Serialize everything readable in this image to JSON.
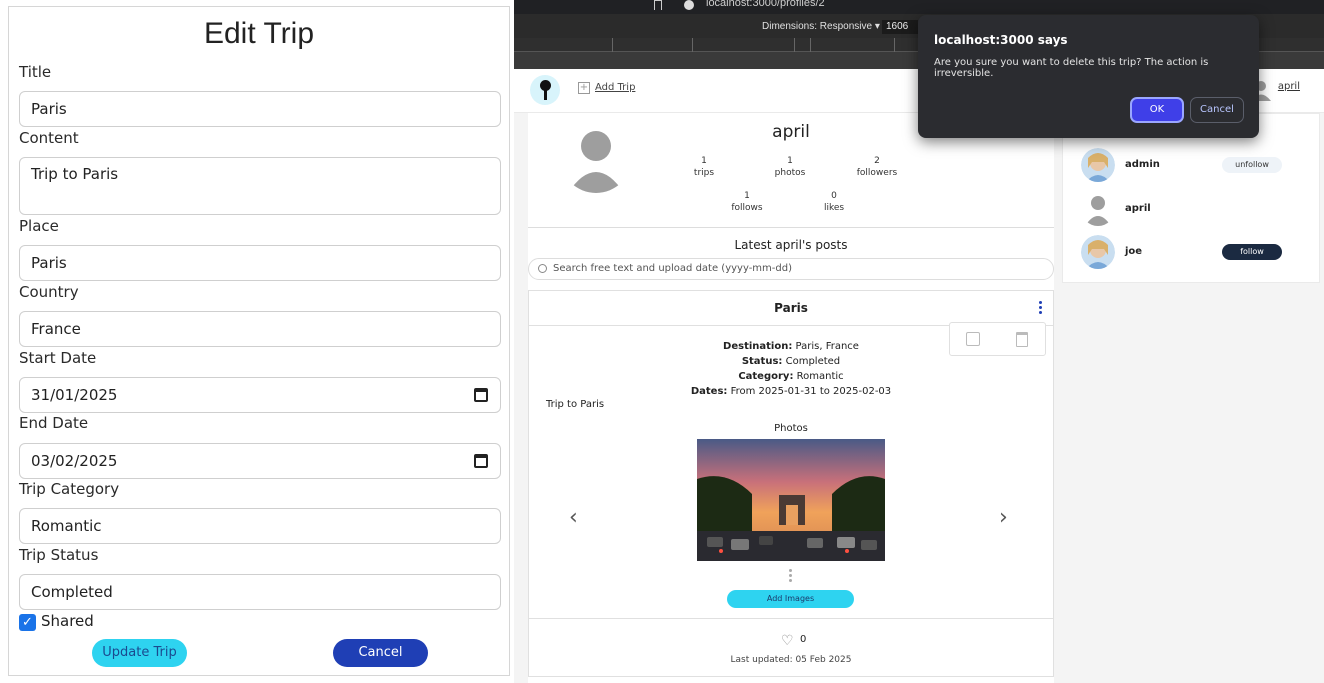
{
  "edit_form": {
    "title": "Edit Trip",
    "fields": {
      "title": {
        "label": "Title",
        "value": "Paris"
      },
      "content": {
        "label": "Content",
        "value": "Trip to Paris"
      },
      "place": {
        "label": "Place",
        "value": "Paris"
      },
      "country": {
        "label": "Country",
        "value": "France"
      },
      "start_date": {
        "label": "Start Date",
        "value": "31/01/2025"
      },
      "end_date": {
        "label": "End Date",
        "value": "03/02/2025"
      },
      "category": {
        "label": "Trip Category",
        "value": "Romantic"
      },
      "status": {
        "label": "Trip Status",
        "value": "Completed"
      }
    },
    "shared": {
      "label": "Shared",
      "checked": true
    },
    "update_label": "Update Trip",
    "cancel_label": "Cancel"
  },
  "browser": {
    "url": "localhost:3000/profiles/2",
    "devtools": {
      "dimensions_label": "Dimensions: Responsive ▾",
      "width_value": "1606"
    }
  },
  "navbar": {
    "add_trip_label": "Add Trip",
    "user_label": "april"
  },
  "profile": {
    "name": "april",
    "stats": [
      {
        "value": "1",
        "label": "trips"
      },
      {
        "value": "1",
        "label": "photos"
      },
      {
        "value": "2",
        "label": "followers"
      },
      {
        "value": "1",
        "label": "follows"
      },
      {
        "value": "0",
        "label": "likes"
      }
    ],
    "latest_title": "Latest april's posts",
    "search_placeholder": "Search free text and upload date (yyyy-mm-dd)"
  },
  "post": {
    "title": "Paris",
    "destination_label": "Destination:",
    "destination_value": "Paris, France",
    "status_label": "Status:",
    "status_value": "Completed",
    "category_label": "Category:",
    "category_value": "Romantic",
    "dates_label": "Dates:",
    "dates_value": "From 2025-01-31 to 2025-02-03",
    "content": "Trip to Paris",
    "photos_label": "Photos",
    "add_images_label": "Add Images",
    "likes": "0",
    "last_updated": "Last updated: 05 Feb 2025"
  },
  "users": [
    {
      "name": "admin",
      "button": "unfollow"
    },
    {
      "name": "april",
      "button": ""
    },
    {
      "name": "joe",
      "button": "follow"
    }
  ],
  "dialog": {
    "title": "localhost:3000 says",
    "message": "Are you sure you want to delete this trip? The action is irreversible.",
    "ok_label": "OK",
    "cancel_label": "Cancel"
  }
}
